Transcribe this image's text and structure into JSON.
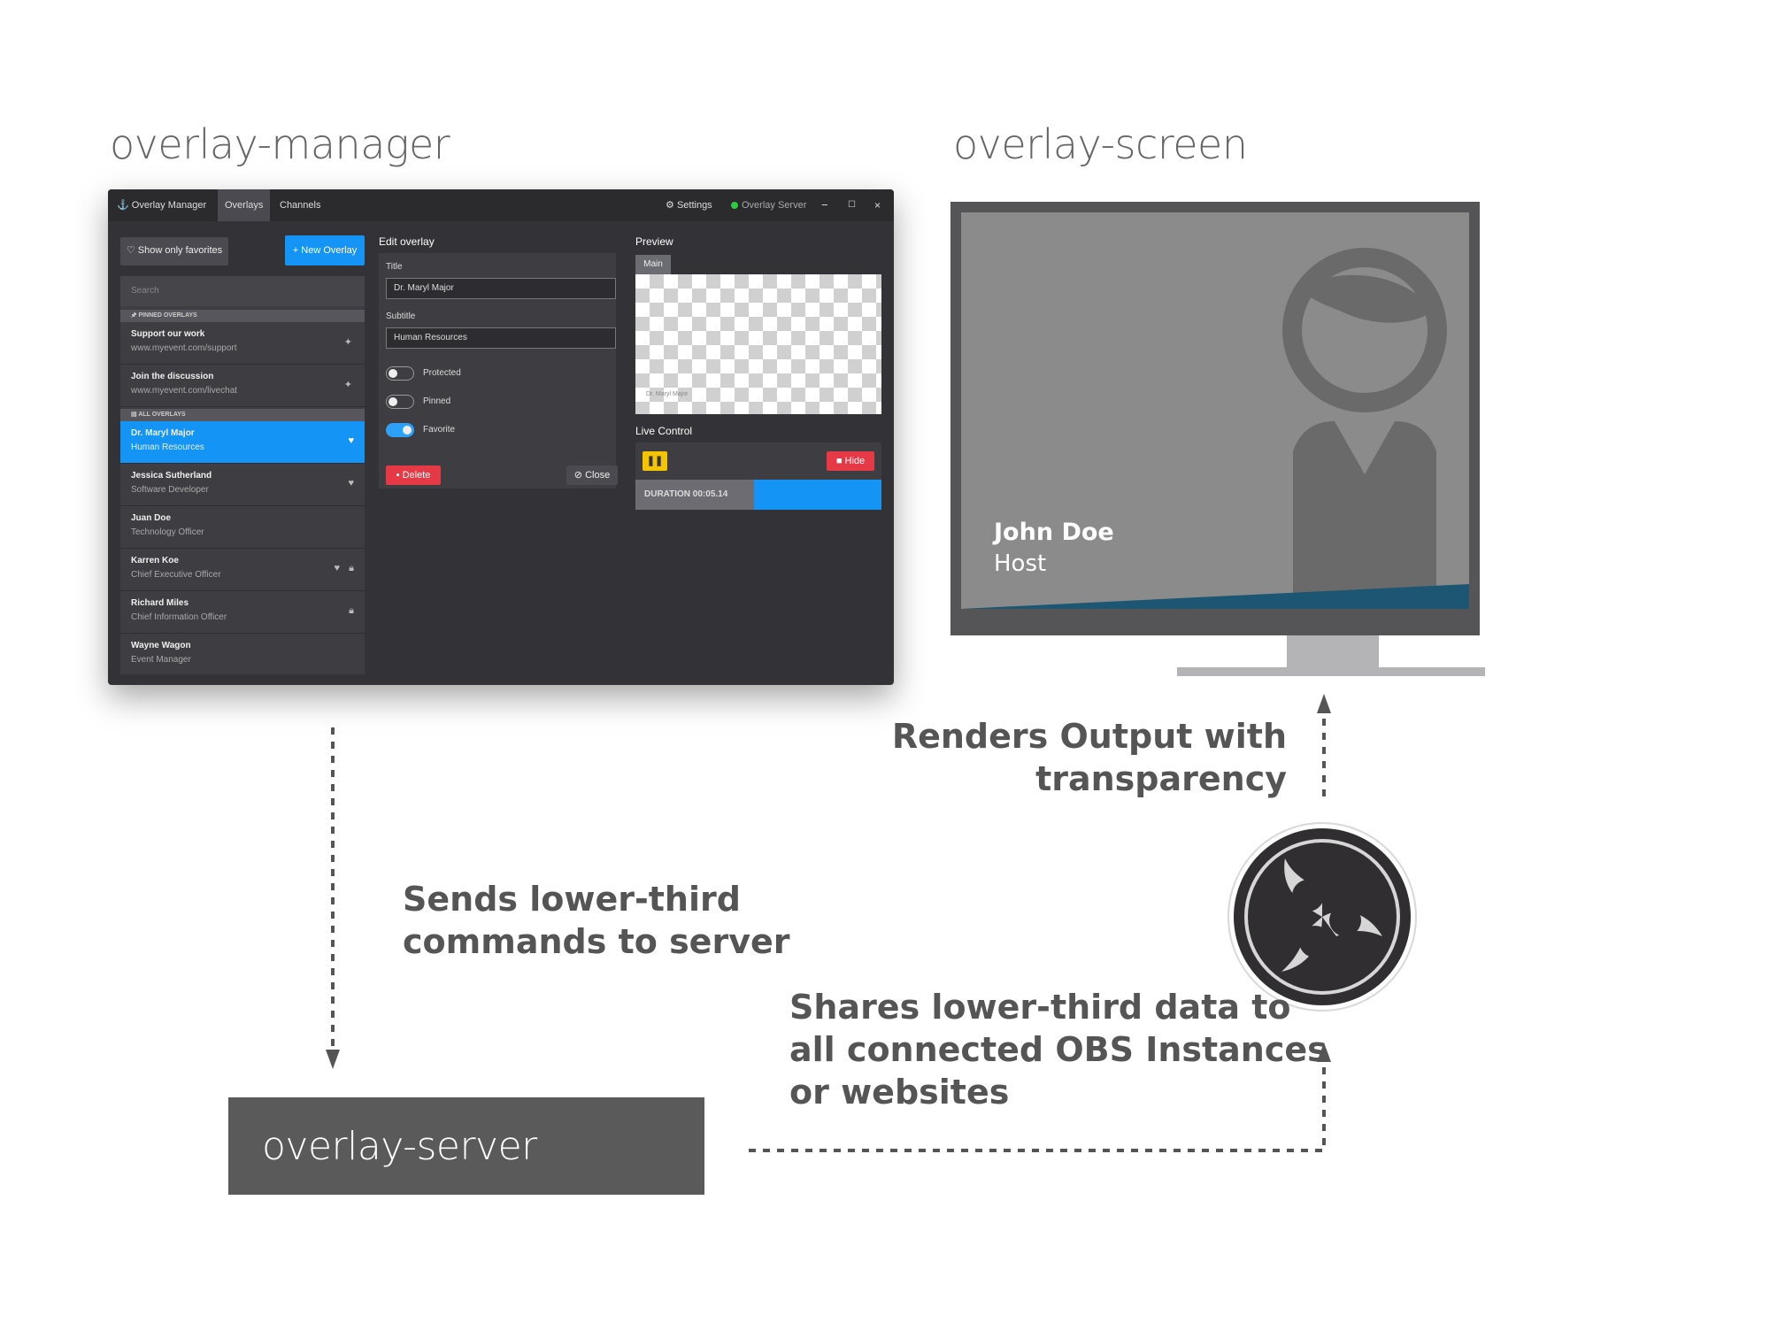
{
  "headings": {
    "manager": "overlay-manager",
    "screen": "overlay-screen",
    "server": "overlay-server"
  },
  "labels": {
    "renders": [
      "Renders Output with",
      "transparency"
    ],
    "sends": [
      "Sends lower-third",
      "commands to server"
    ],
    "shares": [
      "Shares lower-third data to",
      "all connected OBS Instances",
      "or websites"
    ]
  },
  "app": {
    "title": "Overlay Manager",
    "tabs": [
      "Overlays",
      "Channels"
    ],
    "settings": "Settings",
    "server_status": "Overlay Server",
    "show_favorites": "Show only favorites",
    "new_overlay": "New Overlay",
    "search_placeholder": "Search",
    "pinned_header": "PINNED OVERLAYS",
    "all_header": "ALL OVERLAYS",
    "pinned": [
      {
        "title": "Support our work",
        "subtitle": "www.myevent.com/support"
      },
      {
        "title": "Join the discussion",
        "subtitle": "www.myevent.com/livechat"
      }
    ],
    "overlays": [
      {
        "title": "Dr. Maryl Major",
        "subtitle": "Human Resources"
      },
      {
        "title": "Jessica Sutherland",
        "subtitle": "Software Developer"
      },
      {
        "title": "Juan Doe",
        "subtitle": "Technology Officer"
      },
      {
        "title": "Karren Koe",
        "subtitle": "Chief Executive Officer"
      },
      {
        "title": "Richard Miles",
        "subtitle": "Chief Information Officer"
      },
      {
        "title": "Wayne Wagon",
        "subtitle": "Event Manager"
      }
    ],
    "edit": {
      "heading": "Edit overlay",
      "title_label": "Title",
      "title_value": "Dr. Maryl Major",
      "subtitle_label": "Subtitle",
      "subtitle_value": "Human Resources",
      "protected": "Protected",
      "pinned": "Pinned",
      "favorite": "Favorite",
      "delete": "Delete",
      "close": "Close"
    },
    "preview": {
      "heading": "Preview",
      "tab": "Main",
      "mini_text": "Dr. Maryl Major"
    },
    "live": {
      "heading": "Live Control",
      "hide": "Hide",
      "duration": "DURATION 00:05.14"
    }
  },
  "screen": {
    "name": "John Doe",
    "role": "Host"
  },
  "colors": {
    "accent": "#1494f5",
    "lower_third": "#1d5672",
    "hide_button": "#e53946",
    "pause_button": "#f5c400"
  }
}
